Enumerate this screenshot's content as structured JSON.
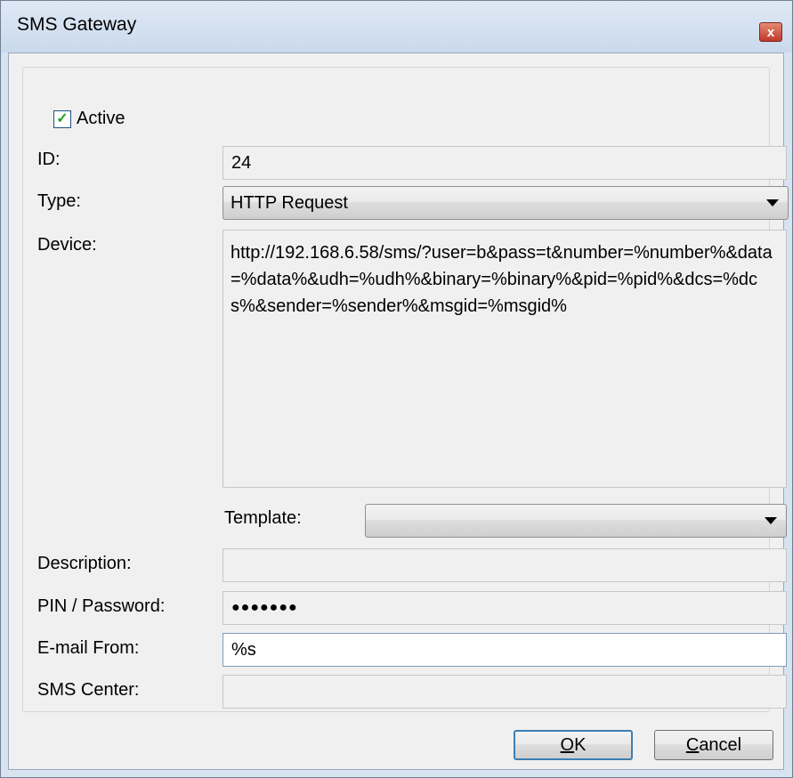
{
  "window": {
    "title": "SMS Gateway",
    "close_glyph": "x"
  },
  "form": {
    "active_label": "Active",
    "active_checked": true,
    "active_check_glyph": "✓",
    "id_label": "ID:",
    "id_value": "24",
    "type_label": "Type:",
    "type_value": "HTTP Request",
    "device_label": "Device:",
    "device_value": "http://192.168.6.58/sms/?user=b&pass=t&number=%number%&data=%data%&udh=%udh%&binary=%binary%&pid=%pid%&dcs=%dcs%&sender=%sender%&msgid=%msgid%",
    "template_label": "Template:",
    "template_value": "",
    "description_label": "Description:",
    "description_value": "",
    "pin_label": "PIN / Password:",
    "pin_value": "●●●●●●●",
    "email_from_label": "E-mail From:",
    "email_from_value": "%s",
    "sms_center_label": "SMS Center:",
    "sms_center_value": ""
  },
  "buttons": {
    "ok_mnemonic": "O",
    "ok_rest": "K",
    "cancel_mnemonic": "C",
    "cancel_rest": "ancel"
  },
  "icons": {
    "close": "close-icon",
    "dropdown": "chevron-down-icon",
    "check": "check-icon"
  }
}
